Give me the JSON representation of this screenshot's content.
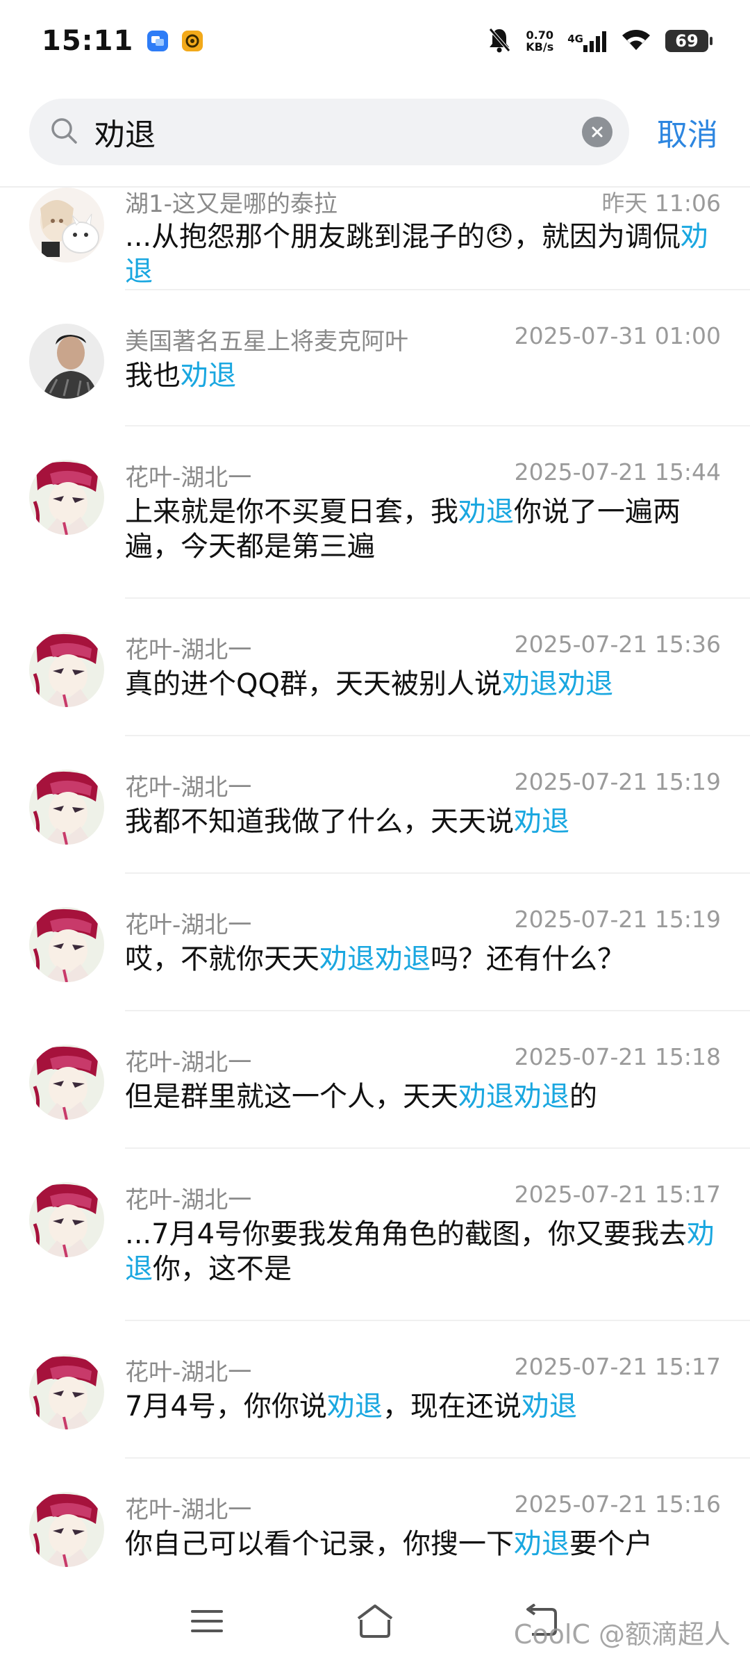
{
  "status_bar": {
    "time": "15:11",
    "speed_value": "0.70",
    "speed_unit": "KB/s",
    "network": "4G",
    "battery": "69"
  },
  "search": {
    "query": "劝退",
    "cancel_label": "取消"
  },
  "results": [
    {
      "sender": "湖1-这又是哪的泰拉",
      "time": "昨天 11:06",
      "avatar": "cat-girl",
      "parts": [
        {
          "t": "...从抱怨那个朋友跳到混子的"
        },
        {
          "emoji": "😞"
        },
        {
          "t": "，就因为调侃"
        },
        {
          "t": "劝退",
          "hl": true
        }
      ]
    },
    {
      "sender": "美国著名五星上将麦克阿叶",
      "time": "2025-07-31 01:00",
      "avatar": "photo",
      "parts": [
        {
          "t": "我也"
        },
        {
          "t": "劝退",
          "hl": true
        }
      ]
    },
    {
      "sender": "花叶-湖北一",
      "time": "2025-07-21 15:44",
      "avatar": "anime",
      "parts": [
        {
          "t": "上来就是你不买夏日套，我"
        },
        {
          "t": "劝退",
          "hl": true
        },
        {
          "t": "你说了一遍两遍，今天都是第三遍"
        }
      ]
    },
    {
      "sender": "花叶-湖北一",
      "time": "2025-07-21 15:36",
      "avatar": "anime",
      "parts": [
        {
          "t": "真的进个QQ群，天天被别人说"
        },
        {
          "t": "劝退劝退",
          "hl": true
        }
      ]
    },
    {
      "sender": "花叶-湖北一",
      "time": "2025-07-21 15:19",
      "avatar": "anime",
      "parts": [
        {
          "t": "我都不知道我做了什么，天天说"
        },
        {
          "t": "劝退",
          "hl": true
        }
      ]
    },
    {
      "sender": "花叶-湖北一",
      "time": "2025-07-21 15:19",
      "avatar": "anime",
      "parts": [
        {
          "t": "哎，不就你天天"
        },
        {
          "t": "劝退劝退",
          "hl": true
        },
        {
          "t": "吗？还有什么？"
        }
      ]
    },
    {
      "sender": "花叶-湖北一",
      "time": "2025-07-21 15:18",
      "avatar": "anime",
      "parts": [
        {
          "t": "但是群里就这一个人，天天"
        },
        {
          "t": "劝退劝退",
          "hl": true
        },
        {
          "t": "的"
        }
      ]
    },
    {
      "sender": "花叶-湖北一",
      "time": "2025-07-21 15:17",
      "avatar": "anime",
      "parts": [
        {
          "t": "...7月4号你要我发角角色的截图，你又要我去"
        },
        {
          "t": "劝退",
          "hl": true
        },
        {
          "t": "你，这不是"
        }
      ]
    },
    {
      "sender": "花叶-湖北一",
      "time": "2025-07-21 15:17",
      "avatar": "anime",
      "parts": [
        {
          "t": "7月4号，你你说"
        },
        {
          "t": "劝退",
          "hl": true
        },
        {
          "t": "，现在还说"
        },
        {
          "t": "劝退",
          "hl": true
        }
      ]
    },
    {
      "sender": "花叶-湖北一",
      "time": "2025-07-21 15:16",
      "avatar": "anime",
      "parts": [
        {
          "t": "你自己可以看个记录，你搜一下"
        },
        {
          "t": "劝退",
          "hl": true
        },
        {
          "t": "要个户"
        }
      ]
    }
  ],
  "watermark": "CoolC @额滴超人",
  "colors": {
    "highlight": "#1aa7e0",
    "cancel": "#2d86e0",
    "search_bg": "#f1f2f4"
  }
}
